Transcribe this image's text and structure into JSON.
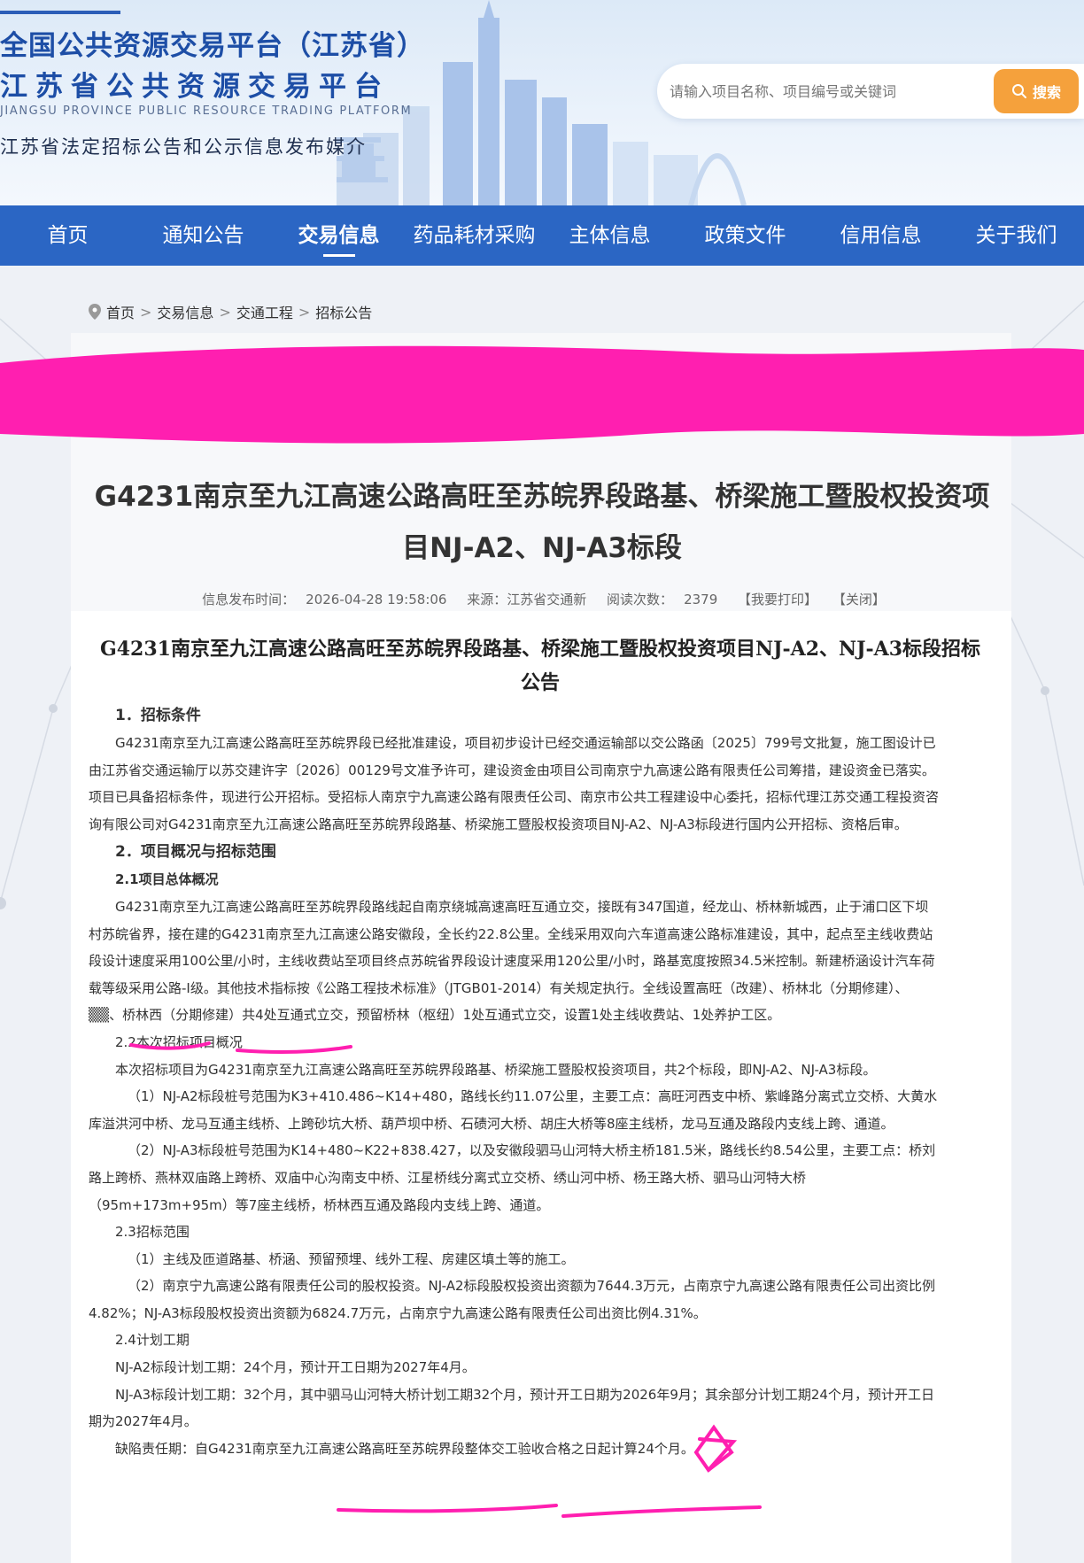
{
  "header": {
    "title_national": "全国公共资源交易平台（江苏省）",
    "title_province": "江苏省公共资源交易平台",
    "title_en": "JIANGSU PROVINCE PUBLIC RESOURCE TRADING PLATFORM",
    "media_statement": "江苏省法定招标公告和公示信息发布媒介",
    "search_placeholder": "请输入项目名称、项目编号或关键词",
    "search_button": "搜索"
  },
  "nav": {
    "items": [
      "首页",
      "通知公告",
      "交易信息",
      "药品耗材采购",
      "主体信息",
      "政策文件",
      "信用信息",
      "关于我们"
    ],
    "active_index": 2
  },
  "breadcrumb": [
    "首页",
    "交易信息",
    "交通工程",
    "招标公告"
  ],
  "article": {
    "title": "G4231南京至九江高速公路高旺至苏皖界段路基、桥梁施工暨股权投资项目NJ-A2、NJ-A3标段",
    "meta_publish_label": "信息发布时间：",
    "meta_publish_time": "2026-04-28 19:58:06",
    "meta_source": "来源：江苏省交通新",
    "meta_views_label": "阅读次数：",
    "meta_views": "2379",
    "print_link": "【我要打印】",
    "close_link": "【关闭】",
    "notice_title": "G4231南京至九江高速公路高旺至苏皖界段路基、桥梁施工暨股权投资项目NJ-A2、NJ-A3标段招标公告"
  },
  "body": {
    "s1": "1．招标条件",
    "p1": "G4231南京至九江高速公路高旺至苏皖界段已经批准建设，项目初步设计已经交通运输部以交公路函〔2025〕799号文批复，施工图设计已由江苏省交通运输厅以苏交建许字〔2026〕00129号文准予许可，建设资金由项目公司南京宁九高速公路有限责任公司筹措，建设资金已落实。项目已具备招标条件，现进行公开招标。受招标人南京宁九高速公路有限责任公司、南京市公共工程建设中心委托，招标代理江苏交通工程投资咨询有限公司对G4231南京至九江高速公路高旺至苏皖界段路基、桥梁施工暨股权投资项目NJ-A2、NJ-A3标段进行国内公开招标、资格后审。",
    "s2": "2．项目概况与招标范围",
    "s21": "2.1项目总体概况",
    "p21": "G4231南京至九江高速公路高旺至苏皖界段路线起自南京绕城高速高旺互通立交，接既有347国道，经龙山、桥林新城西，止于浦口区下坝村苏皖省界，接在建的G4231南京至九江高速公路安徽段，全长约22.8公里。全线采用双向六车道高速公路标准建设，其中，起点至主线收费站段设计速度采用100公里/小时，主线收费站至项目终点苏皖省界段设计速度采用120公里/小时，路基宽度按照34.5米控制。新建桥涵设计汽车荷载等级采用公路-I级。其他技术指标按《公路工程技术标准》（JTGB01-2014）有关规定执行。全线设置高旺（改建）、桥林北（分期修建）、▒▒、桥林西（分期修建）共4处互通式立交，预留桥林（枢纽）1处互通式立交，设置1处主线收费站、1处养护工区。",
    "s22": "2.2本次招标项目概况",
    "p22": "本次招标项目为G4231南京至九江高速公路高旺至苏皖界段路基、桥梁施工暨股权投资项目，共2个标段，即NJ-A2、NJ-A3标段。",
    "p22a": "（1）NJ-A2标段桩号范围为K3+410.486~K14+480，路线长约11.07公里，主要工点：高旺河西支中桥、紫峰路分离式立交桥、大黄水库溢洪河中桥、龙马互通主线桥、上跨砂坑大桥、葫芦坝中桥、石碛河大桥、胡庄大桥等8座主线桥，龙马互通及路段内支线上跨、通道。",
    "p22b": "（2）NJ-A3标段桩号范围为K14+480~K22+838.427，以及安徽段驷马山河特大桥主桥181.5米，路线长约8.54公里，主要工点：桥刘路上跨桥、燕林双庙路上跨桥、双庙中心沟南支中桥、江星桥线分离式立交桥、绣山河中桥、杨王路大桥、驷马山河特大桥（95m+173m+95m）等7座主线桥，桥林西互通及路段内支线上跨、通道。",
    "s23": "2.3招标范围",
    "p23a": "（1）主线及匝道路基、桥涵、预留预埋、线外工程、房建区填土等的施工。",
    "p23b": "（2）南京宁九高速公路有限责任公司的股权投资。NJ-A2标段股权投资出资额为7644.3万元，占南京宁九高速公路有限责任公司出资比例4.82%；NJ-A3标段股权投资出资额为6824.7万元，占南京宁九高速公路有限责任公司出资比例4.31%。",
    "s24": "2.4计划工期",
    "p24a": "NJ-A2标段计划工期：24个月，预计开工日期为2027年4月。",
    "p24b": "NJ-A3标段计划工期：32个月，其中驷马山河特大桥计划工期32个月，预计开工日期为2026年9月；其余部分计划工期24个月，预计开工日期为2027年4月。",
    "p25": "缺陷责任期：自G4231南京至九江高速公路高旺至苏皖界段整体交工验收合格之日起计算24个月。"
  },
  "colors": {
    "nav_bg": "#2b66c4",
    "brand_blue": "#1d4ea6",
    "search_button": "#f5a13c",
    "scribble_magenta": "#ff1fb0"
  }
}
